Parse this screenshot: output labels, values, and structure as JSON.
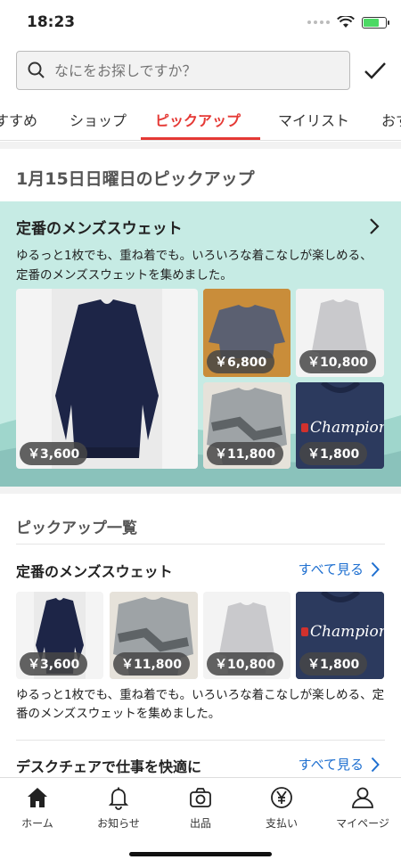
{
  "status": {
    "time": "18:23"
  },
  "search": {
    "placeholder": "なにをお探しですか？"
  },
  "tabs": [
    {
      "label": "すすめ"
    },
    {
      "label": "ショップ"
    },
    {
      "label": "ピックアップ"
    },
    {
      "label": "マイリスト"
    },
    {
      "label": "おす"
    }
  ],
  "pickup": {
    "date_heading": "1月15日日曜日のピックアップ",
    "feature": {
      "title": "定番のメンズスウェット",
      "description": "ゆるっと1枚でも、重ね着でも。いろいろな着こなしが楽しめる、定番のメンズスウェットを集めました。",
      "items": [
        {
          "price": "￥3,600"
        },
        {
          "price": "￥6,800"
        },
        {
          "price": "￥10,800"
        },
        {
          "price": "￥11,800"
        },
        {
          "price": "￥1,800"
        }
      ]
    }
  },
  "list": {
    "heading": "ピックアップ一覧",
    "sections": [
      {
        "title": "定番のメンズスウェット",
        "see_all": "すべて見る",
        "items": [
          {
            "price": "￥3,600"
          },
          {
            "price": "￥11,800"
          },
          {
            "price": "￥10,800"
          },
          {
            "price": "￥1,800"
          }
        ],
        "description": "ゆるっと1枚でも、重ね着でも。いろいろな着こなしが楽しめる、定番のメンズスウェットを集めました。"
      },
      {
        "title": "デスクチェアで仕事を快適に",
        "see_all": "すべて見る"
      }
    ]
  },
  "nav": [
    {
      "label": "ホーム",
      "icon": "home-icon"
    },
    {
      "label": "お知らせ",
      "icon": "bell-icon"
    },
    {
      "label": "出品",
      "icon": "camera-icon"
    },
    {
      "label": "支払い",
      "icon": "yen-icon"
    },
    {
      "label": "マイページ",
      "icon": "person-icon"
    }
  ],
  "colors": {
    "accent": "#e53935",
    "link": "#1e6fd0",
    "feature_bg": "#c6ebe4"
  }
}
